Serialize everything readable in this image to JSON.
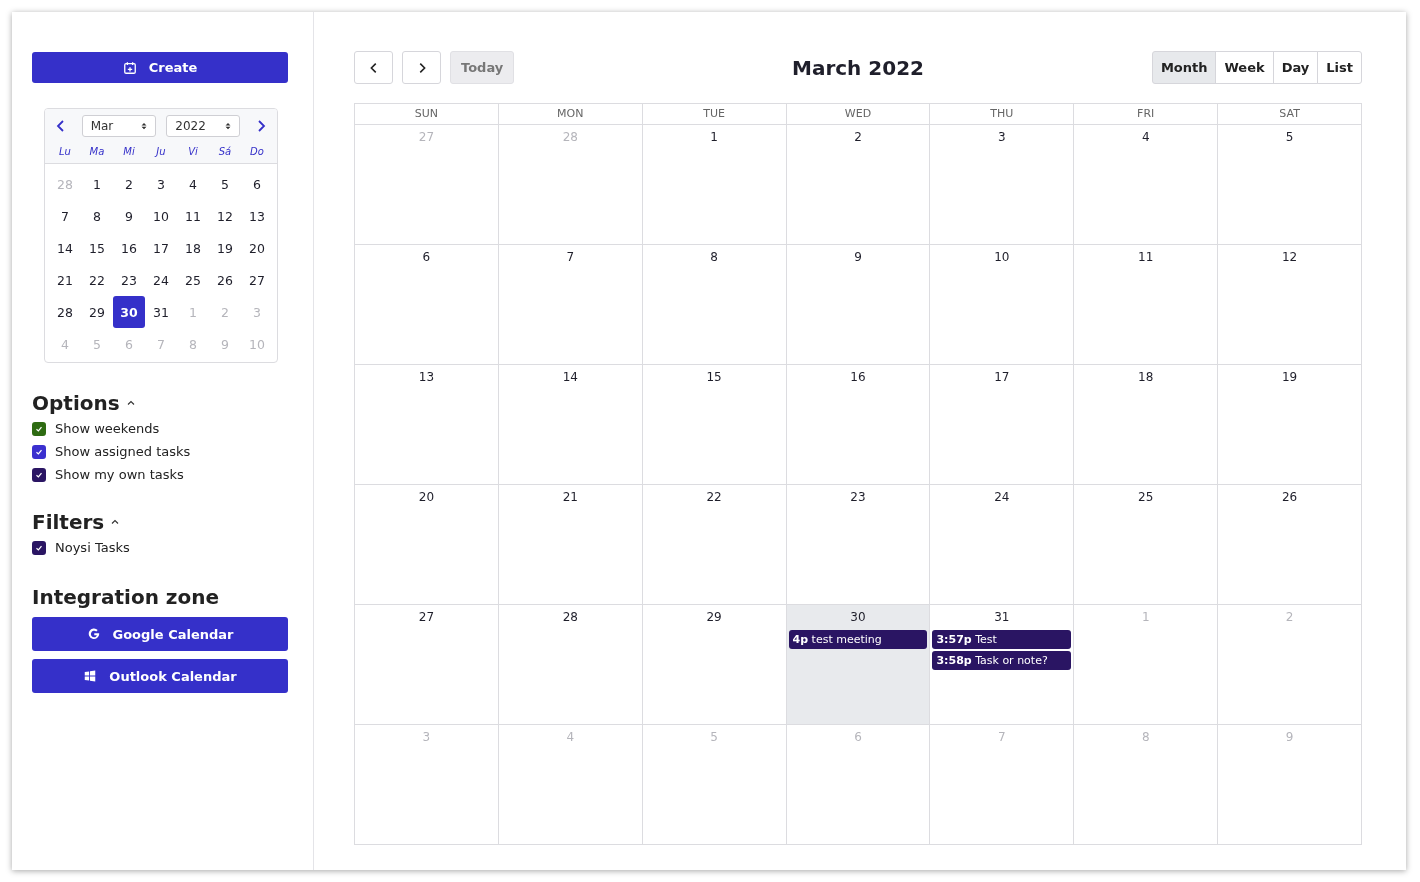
{
  "sidebar": {
    "create_button": "Create",
    "mini_calendar": {
      "month": "Mar",
      "year": "2022",
      "weekdays": [
        "Lu",
        "Ma",
        "Mi",
        "Ju",
        "Vi",
        "Sá",
        "Do"
      ],
      "days": [
        {
          "label": "28",
          "muted": true,
          "selected": false
        },
        {
          "label": "1",
          "muted": false,
          "selected": false
        },
        {
          "label": "2",
          "muted": false,
          "selected": false
        },
        {
          "label": "3",
          "muted": false,
          "selected": false
        },
        {
          "label": "4",
          "muted": false,
          "selected": false
        },
        {
          "label": "5",
          "muted": false,
          "selected": false
        },
        {
          "label": "6",
          "muted": false,
          "selected": false
        },
        {
          "label": "7",
          "muted": false,
          "selected": false
        },
        {
          "label": "8",
          "muted": false,
          "selected": false
        },
        {
          "label": "9",
          "muted": false,
          "selected": false
        },
        {
          "label": "10",
          "muted": false,
          "selected": false
        },
        {
          "label": "11",
          "muted": false,
          "selected": false
        },
        {
          "label": "12",
          "muted": false,
          "selected": false
        },
        {
          "label": "13",
          "muted": false,
          "selected": false
        },
        {
          "label": "14",
          "muted": false,
          "selected": false
        },
        {
          "label": "15",
          "muted": false,
          "selected": false
        },
        {
          "label": "16",
          "muted": false,
          "selected": false
        },
        {
          "label": "17",
          "muted": false,
          "selected": false
        },
        {
          "label": "18",
          "muted": false,
          "selected": false
        },
        {
          "label": "19",
          "muted": false,
          "selected": false
        },
        {
          "label": "20",
          "muted": false,
          "selected": false
        },
        {
          "label": "21",
          "muted": false,
          "selected": false
        },
        {
          "label": "22",
          "muted": false,
          "selected": false
        },
        {
          "label": "23",
          "muted": false,
          "selected": false
        },
        {
          "label": "24",
          "muted": false,
          "selected": false
        },
        {
          "label": "25",
          "muted": false,
          "selected": false
        },
        {
          "label": "26",
          "muted": false,
          "selected": false
        },
        {
          "label": "27",
          "muted": false,
          "selected": false
        },
        {
          "label": "28",
          "muted": false,
          "selected": false
        },
        {
          "label": "29",
          "muted": false,
          "selected": false
        },
        {
          "label": "30",
          "muted": false,
          "selected": true
        },
        {
          "label": "31",
          "muted": false,
          "selected": false
        },
        {
          "label": "1",
          "muted": true,
          "selected": false
        },
        {
          "label": "2",
          "muted": true,
          "selected": false
        },
        {
          "label": "3",
          "muted": true,
          "selected": false
        },
        {
          "label": "4",
          "muted": true,
          "selected": false
        },
        {
          "label": "5",
          "muted": true,
          "selected": false
        },
        {
          "label": "6",
          "muted": true,
          "selected": false
        },
        {
          "label": "7",
          "muted": true,
          "selected": false
        },
        {
          "label": "8",
          "muted": true,
          "selected": false
        },
        {
          "label": "9",
          "muted": true,
          "selected": false
        },
        {
          "label": "10",
          "muted": true,
          "selected": false
        }
      ]
    },
    "sections": [
      {
        "title": "Options",
        "expanded": true,
        "items": [
          {
            "label": "Show weekends",
            "checked": true,
            "color": "#2e6b12"
          },
          {
            "label": "Show assigned tasks",
            "checked": true,
            "color": "#3b30cf"
          },
          {
            "label": "Show my own tasks",
            "checked": true,
            "color": "#2a1563"
          }
        ]
      },
      {
        "title": "Filters",
        "expanded": true,
        "items": [
          {
            "label": "Noysi Tasks",
            "checked": true,
            "color": "#2a1563"
          }
        ]
      }
    ],
    "integration": {
      "title": "Integration zone",
      "buttons": [
        {
          "kind": "google",
          "label": "Google Calendar"
        },
        {
          "kind": "outlook",
          "label": "Outlook Calendar"
        }
      ]
    }
  },
  "toolbar": {
    "today_button": "Today",
    "title": "March 2022",
    "views": [
      {
        "label": "Month",
        "selected": true
      },
      {
        "label": "Week",
        "selected": false
      },
      {
        "label": "Day",
        "selected": false
      },
      {
        "label": "List",
        "selected": false
      }
    ]
  },
  "calendar": {
    "weekdays": [
      "SUN",
      "MON",
      "TUE",
      "WED",
      "THU",
      "FRI",
      "SAT"
    ],
    "days": [
      {
        "label": "27",
        "muted": true,
        "today": false
      },
      {
        "label": "28",
        "muted": true,
        "today": false
      },
      {
        "label": "1",
        "muted": false,
        "today": false
      },
      {
        "label": "2",
        "muted": false,
        "today": false
      },
      {
        "label": "3",
        "muted": false,
        "today": false
      },
      {
        "label": "4",
        "muted": false,
        "today": false
      },
      {
        "label": "5",
        "muted": false,
        "today": false
      },
      {
        "label": "6",
        "muted": false,
        "today": false
      },
      {
        "label": "7",
        "muted": false,
        "today": false
      },
      {
        "label": "8",
        "muted": false,
        "today": false
      },
      {
        "label": "9",
        "muted": false,
        "today": false
      },
      {
        "label": "10",
        "muted": false,
        "today": false
      },
      {
        "label": "11",
        "muted": false,
        "today": false
      },
      {
        "label": "12",
        "muted": false,
        "today": false
      },
      {
        "label": "13",
        "muted": false,
        "today": false
      },
      {
        "label": "14",
        "muted": false,
        "today": false
      },
      {
        "label": "15",
        "muted": false,
        "today": false
      },
      {
        "label": "16",
        "muted": false,
        "today": false
      },
      {
        "label": "17",
        "muted": false,
        "today": false
      },
      {
        "label": "18",
        "muted": false,
        "today": false
      },
      {
        "label": "19",
        "muted": false,
        "today": false
      },
      {
        "label": "20",
        "muted": false,
        "today": false
      },
      {
        "label": "21",
        "muted": false,
        "today": false
      },
      {
        "label": "22",
        "muted": false,
        "today": false
      },
      {
        "label": "23",
        "muted": false,
        "today": false
      },
      {
        "label": "24",
        "muted": false,
        "today": false
      },
      {
        "label": "25",
        "muted": false,
        "today": false
      },
      {
        "label": "26",
        "muted": false,
        "today": false
      },
      {
        "label": "27",
        "muted": false,
        "today": false
      },
      {
        "label": "28",
        "muted": false,
        "today": false
      },
      {
        "label": "29",
        "muted": false,
        "today": false
      },
      {
        "label": "30",
        "muted": false,
        "today": true,
        "events": [
          "**4p** test meeting"
        ]
      },
      {
        "label": "31",
        "muted": false,
        "today": false,
        "events": [
          "**3:57p** Test",
          "**3:58p** Task or note?"
        ]
      },
      {
        "label": "1",
        "muted": true,
        "today": false
      },
      {
        "label": "2",
        "muted": true,
        "today": false
      },
      {
        "label": "3",
        "muted": true,
        "today": false
      },
      {
        "label": "4",
        "muted": true,
        "today": false
      },
      {
        "label": "5",
        "muted": true,
        "today": false
      },
      {
        "label": "6",
        "muted": true,
        "today": false
      },
      {
        "label": "7",
        "muted": true,
        "today": false
      },
      {
        "label": "8",
        "muted": true,
        "today": false
      },
      {
        "label": "9",
        "muted": true,
        "today": false
      }
    ]
  }
}
